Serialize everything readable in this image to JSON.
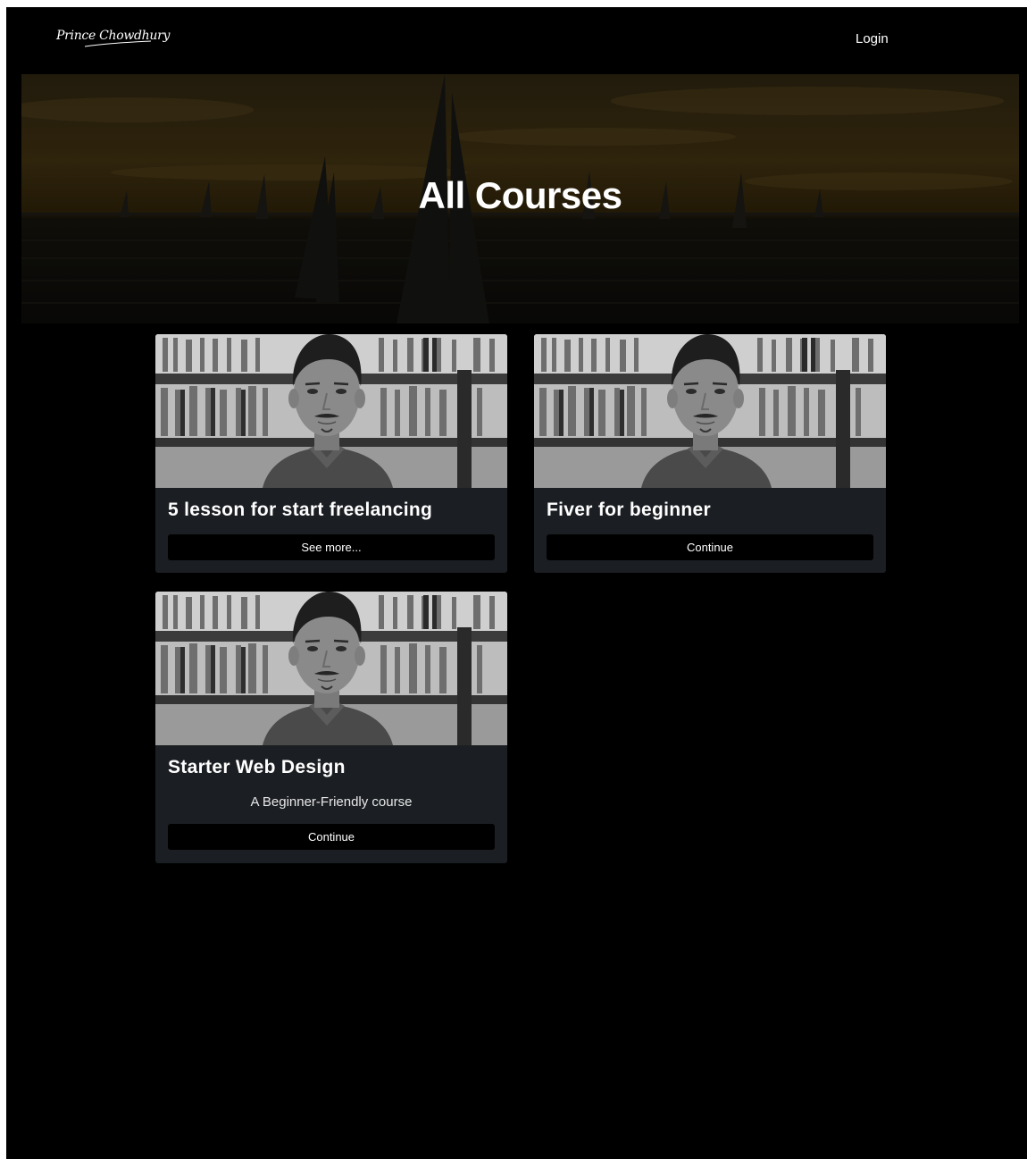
{
  "header": {
    "logo_text": "Prince Chowdhury",
    "login_label": "Login"
  },
  "hero": {
    "title": "All Courses"
  },
  "courses": [
    {
      "title": "5 lesson for start freelancing",
      "description": "",
      "button_label": "See more..."
    },
    {
      "title": "Fiver for beginner",
      "description": "",
      "button_label": "Continue"
    },
    {
      "title": "Starter Web Design",
      "description": "A Beginner-Friendly course",
      "button_label": "Continue"
    }
  ],
  "colors": {
    "page_background": "#000000",
    "card_background": "#1b1e22",
    "button_background": "#000000",
    "text": "#ffffff",
    "hero_sky": "#3a2a0e"
  }
}
